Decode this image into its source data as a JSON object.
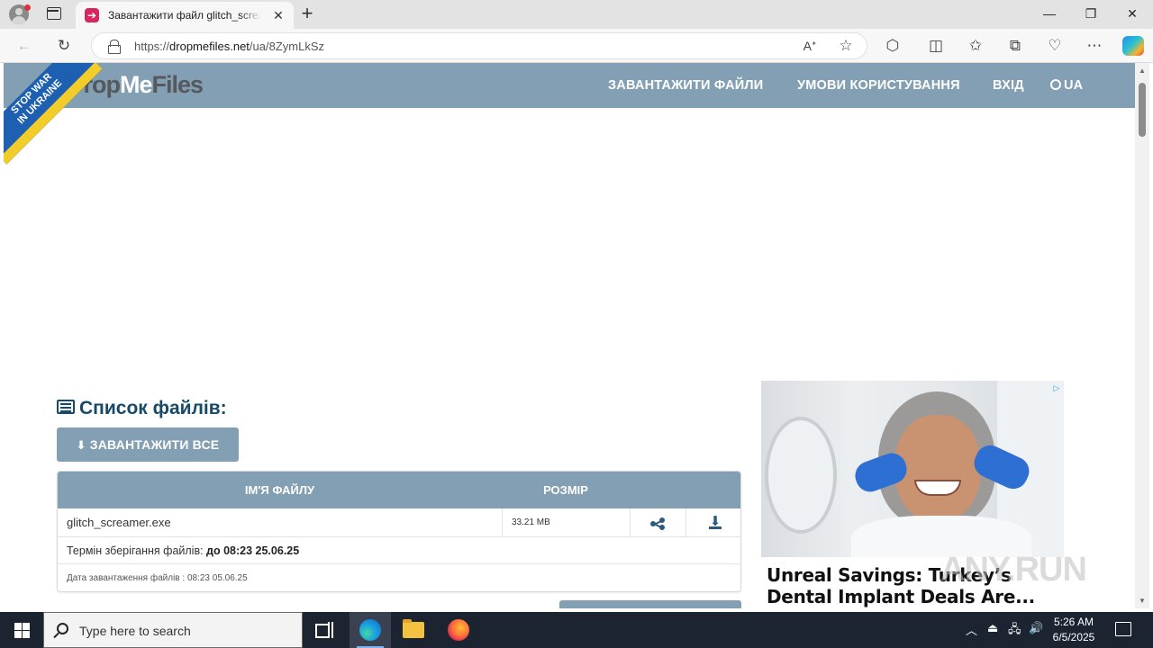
{
  "browser": {
    "tab_title": "Завантажити файл glitch_screamer.exe",
    "url_prefix": "https://",
    "url_host": "dropmefiles.net",
    "url_path": "/ua/8ZymLkSz",
    "new_tab_symbol": "+",
    "close_symbol": "✕",
    "minimize_symbol": "—",
    "maximize_symbol": "❐",
    "window_close_symbol": "✕"
  },
  "site": {
    "logo_drop": "Drop",
    "logo_me": "Me",
    "logo_files": "Files",
    "ribbon_line1": "STOP WAR",
    "ribbon_line2": "IN UKRAINE",
    "nav": {
      "upload": "ЗАВАНТАЖИТИ ФАЙЛИ",
      "terms": "УМОВИ КОРИСТУВАННЯ",
      "login": "ВХІД",
      "lang": "UA"
    }
  },
  "files": {
    "title": "Список файлів:",
    "download_all": "ЗАВАНТАЖИТИ ВСЕ",
    "col_name": "ІМ'Я ФАЙЛУ",
    "col_size": "РОЗМІР",
    "rows": [
      {
        "name": "glitch_screamer.exe",
        "size": "33.21 MB"
      }
    ],
    "storage_label": "Термін зберігання файлів: ",
    "storage_value": "до 08:23 25.06.25",
    "upload_date": "Дата завантаження файлів : 08:23 05.06.25"
  },
  "ad": {
    "headline": "Unreal Savings: Turkey’s Dental Implant Deals Are..."
  },
  "watermark": "ANY.RUN",
  "taskbar": {
    "search_placeholder": "Type here to search",
    "time": "5:26 AM",
    "date": "6/5/2025"
  },
  "colors": {
    "header": "#839fb3",
    "title": "#174a66",
    "taskbar": "#1c2432"
  },
  "icons": [
    "profile-icon",
    "tab-actions-icon",
    "back-icon",
    "refresh-icon",
    "lock-icon",
    "read-aloud-icon",
    "favorite-star-icon",
    "extensions-icon",
    "split-screen-icon",
    "favorites-icon",
    "collections-icon",
    "browser-essentials-icon",
    "more-icon",
    "copilot-icon",
    "globe-icon",
    "list-icon",
    "download-icon",
    "share-icon",
    "windows-start-icon",
    "search-icon",
    "task-view-icon",
    "edge-icon",
    "file-explorer-icon",
    "firefox-icon",
    "notification-icon"
  ]
}
